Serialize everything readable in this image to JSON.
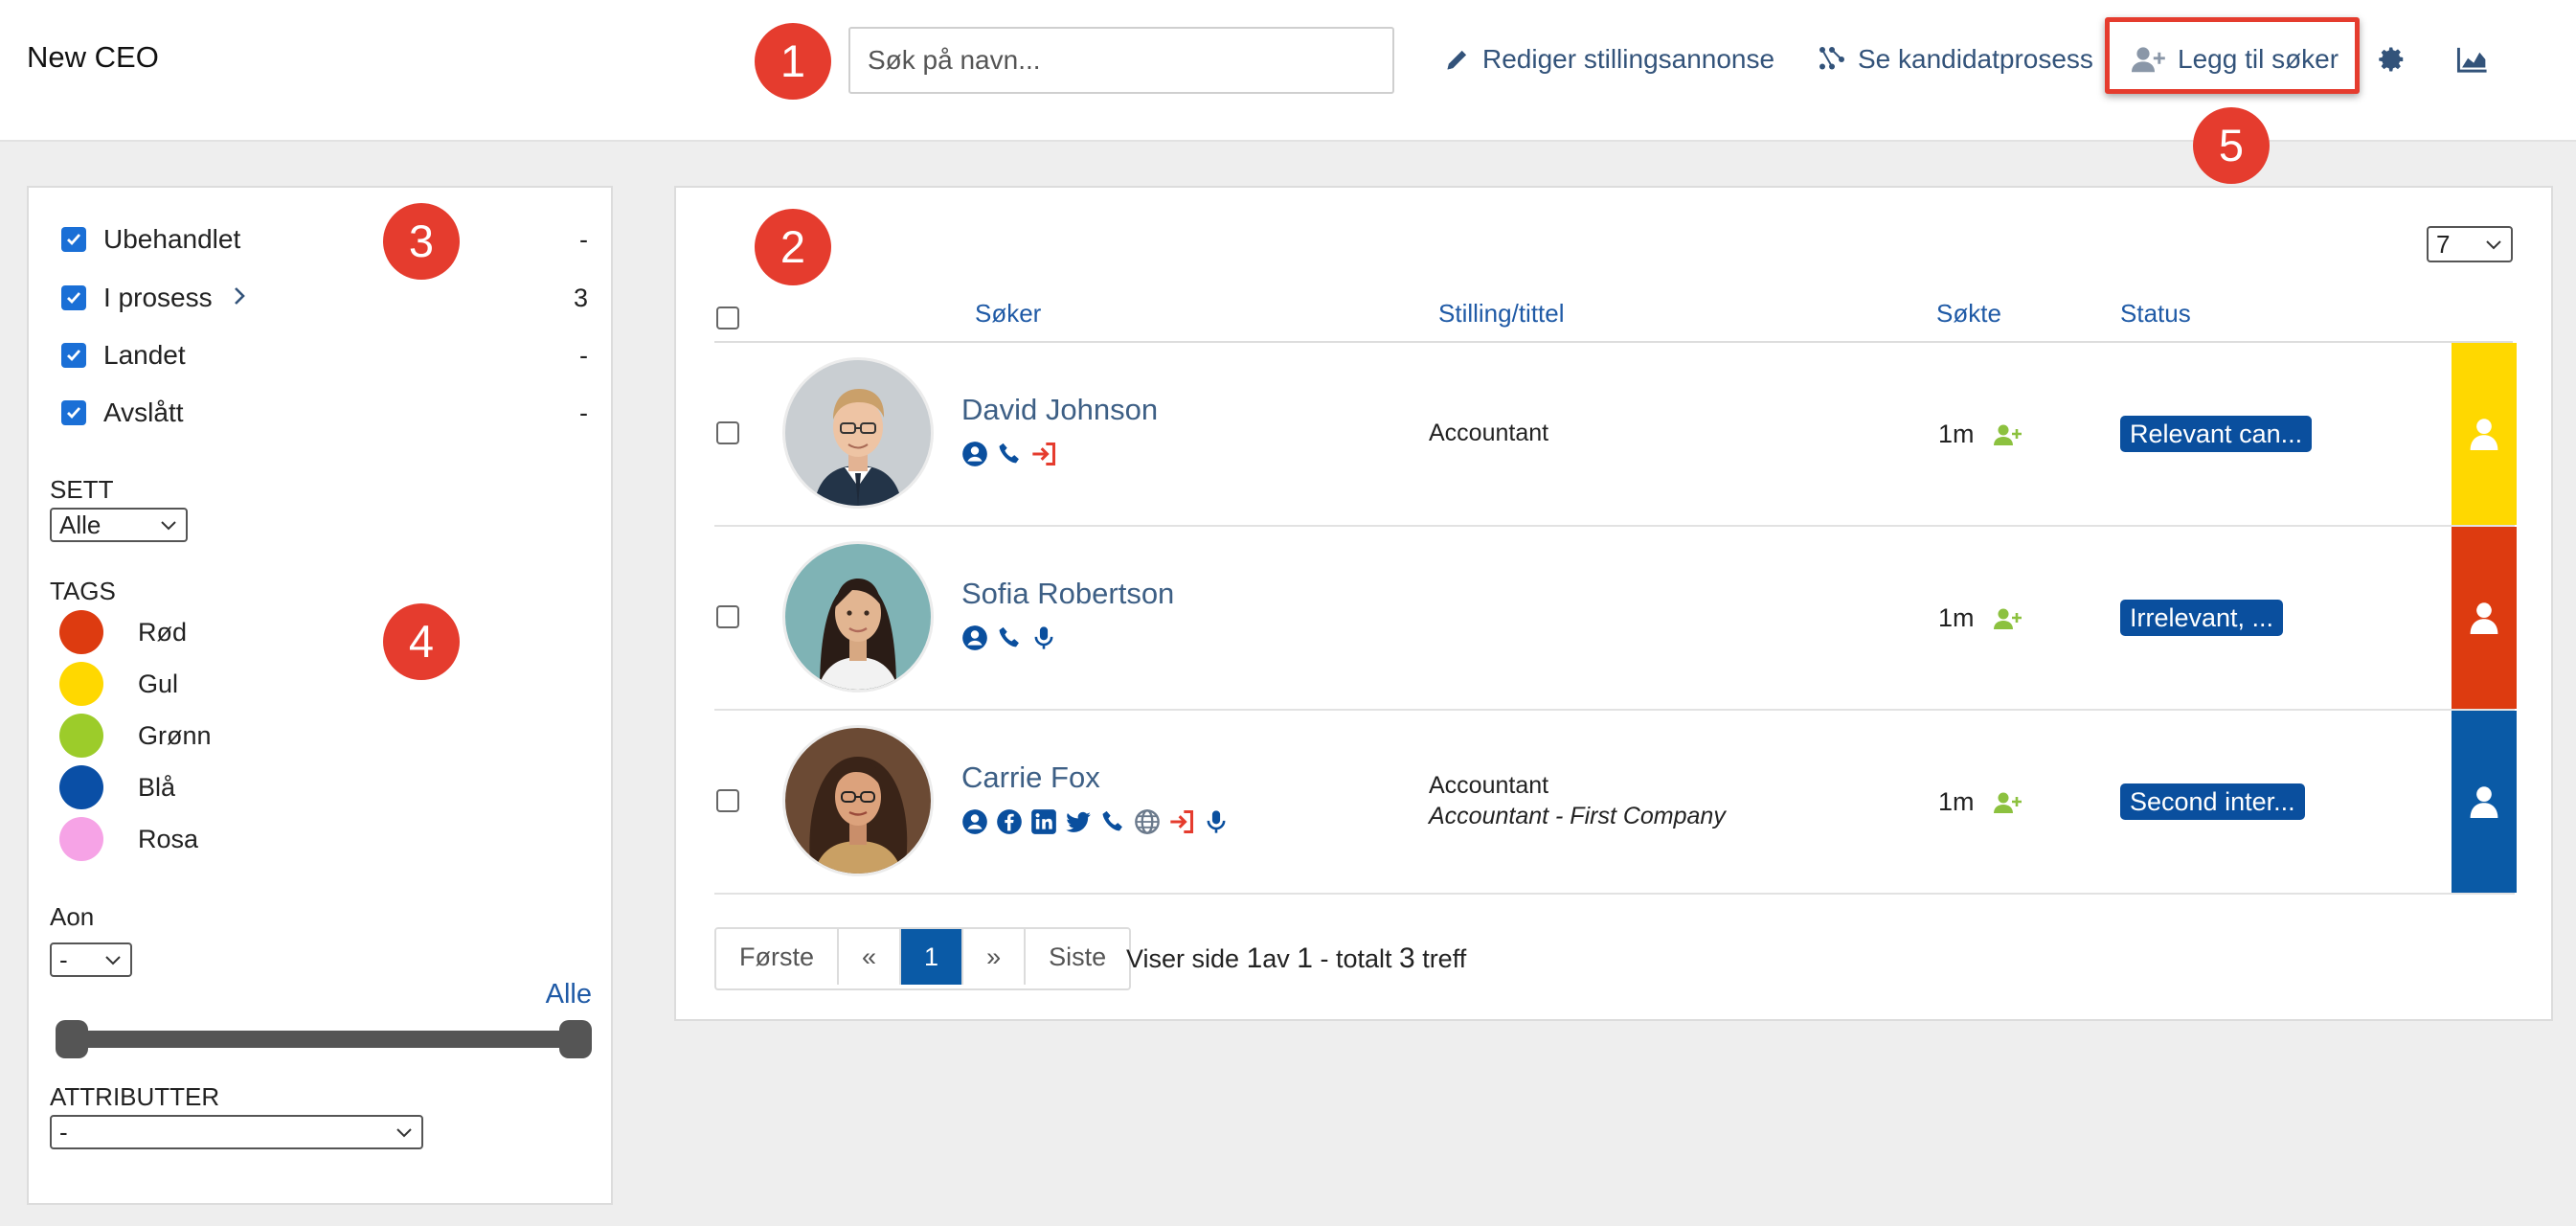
{
  "app": {
    "title": "New CEO"
  },
  "markers": [
    "1",
    "2",
    "3",
    "4",
    "5"
  ],
  "search": {
    "placeholder": "Søk på navn...",
    "value": ""
  },
  "toolbar": {
    "edit_ad": "Rediger stillingsannonse",
    "candidate_process": "Se kandidatprosess",
    "add_applicant": "Legg til søker",
    "settings_icon": "gear-icon",
    "stats_icon": "area-chart-icon"
  },
  "filters": {
    "status": [
      {
        "label": "Ubehandlet",
        "count": "-",
        "checked": true
      },
      {
        "label": "I prosess",
        "count": "3",
        "checked": true,
        "expandable": true
      },
      {
        "label": "Landet",
        "count": "-",
        "checked": true
      },
      {
        "label": "Avslått",
        "count": "-",
        "checked": true
      }
    ],
    "seen": {
      "label": "SETT",
      "value": "Alle"
    },
    "tags": {
      "label": "TAGS",
      "items": [
        {
          "label": "Rød",
          "color": "#dd3b10"
        },
        {
          "label": "Gul",
          "color": "#ffd800"
        },
        {
          "label": "Grønn",
          "color": "#9ccc2a"
        },
        {
          "label": "Blå",
          "color": "#0a4fa6"
        },
        {
          "label": "Rosa",
          "color": "#f6a3e6"
        }
      ]
    },
    "aon": {
      "label": "Aon",
      "value": "-",
      "range_link": "Alle",
      "range_fraction": [
        0.0,
        1.0
      ]
    },
    "attributes": {
      "label": "ATTRIBUTTER",
      "value": "-"
    }
  },
  "table": {
    "per_page": "7",
    "columns": {
      "applicant": "Søker",
      "position": "Stilling/tittel",
      "applied": "Søkte",
      "status": "Status"
    },
    "rows": [
      {
        "name": "David Johnson",
        "position": "Accountant",
        "position_detail": "",
        "applied": "1m",
        "status": "Relevant can...",
        "tag_color": "#ffd800",
        "icons": [
          "profile-icon",
          "phone-icon",
          "sign-in-icon"
        ]
      },
      {
        "name": "Sofia Robertson",
        "position": "",
        "position_detail": "",
        "applied": "1m",
        "status": "Irrelevant, ...",
        "tag_color": "#dd3b10",
        "icons": [
          "profile-icon",
          "phone-icon",
          "microphone-icon"
        ]
      },
      {
        "name": "Carrie Fox",
        "position": "Accountant",
        "position_detail": "Accountant - First Company",
        "applied": "1m",
        "status": "Second inter...",
        "tag_color": "#0a5aa6",
        "icons": [
          "profile-icon",
          "facebook-icon",
          "linkedin-icon",
          "twitter-icon",
          "phone-icon",
          "globe-icon",
          "sign-in-icon",
          "microphone-icon"
        ]
      }
    ]
  },
  "pagination": {
    "first": "Første",
    "prev": "«",
    "current": "1",
    "next": "»",
    "last": "Siste",
    "info_prefix": "Viser side ",
    "page": "1",
    "info_of": "av ",
    "total_pages": "1",
    "info_total": " - totalt ",
    "total_hits": "3",
    "info_suffix": " treff"
  }
}
